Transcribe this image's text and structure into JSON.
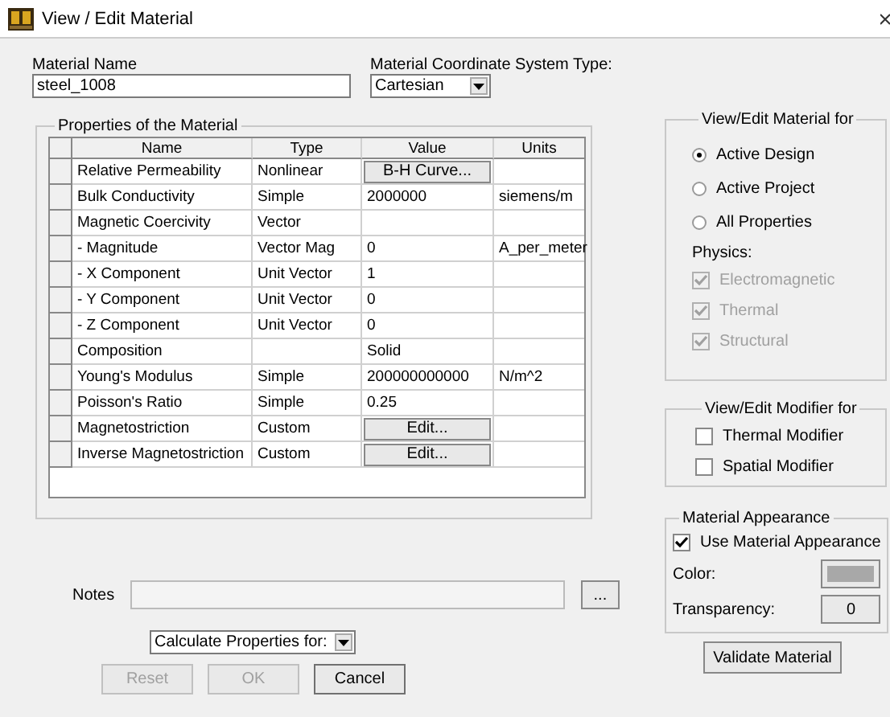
{
  "window": {
    "title": "View / Edit Material"
  },
  "material_name": {
    "label": "Material Name",
    "value": "steel_1008"
  },
  "coordinate_system": {
    "label": "Material Coordinate System Type:",
    "value": "Cartesian"
  },
  "properties": {
    "title": "Properties of the Material",
    "columns": [
      "Name",
      "Type",
      "Value",
      "Units"
    ],
    "rows": [
      {
        "name": "Relative Permeability",
        "type": "Nonlinear",
        "kind": "button",
        "value": "B-H Curve...",
        "units": ""
      },
      {
        "name": "Bulk Conductivity",
        "type": "Simple",
        "kind": "text",
        "value": "2000000",
        "units": "siemens/m"
      },
      {
        "name": "Magnetic Coercivity",
        "type": "Vector",
        "kind": "text",
        "value": "",
        "units": ""
      },
      {
        "name": "- Magnitude",
        "type": "Vector Mag",
        "kind": "text",
        "value": "0",
        "units": "A_per_meter"
      },
      {
        "name": "- X Component",
        "type": "Unit Vector",
        "kind": "text",
        "value": "1",
        "units": ""
      },
      {
        "name": "- Y Component",
        "type": "Unit Vector",
        "kind": "text",
        "value": "0",
        "units": ""
      },
      {
        "name": "- Z Component",
        "type": "Unit Vector",
        "kind": "text",
        "value": "0",
        "units": ""
      },
      {
        "name": "Composition",
        "type": "",
        "kind": "text",
        "value": "Solid",
        "units": ""
      },
      {
        "name": "Young's Modulus",
        "type": "Simple",
        "kind": "text",
        "value": "200000000000",
        "units": "N/m^2"
      },
      {
        "name": "Poisson's Ratio",
        "type": "Simple",
        "kind": "text",
        "value": "0.25",
        "units": ""
      },
      {
        "name": "Magnetostriction",
        "type": "Custom",
        "kind": "button",
        "value": "Edit...",
        "units": ""
      },
      {
        "name": "Inverse Magnetostriction",
        "type": "Custom",
        "kind": "button",
        "value": "Edit...",
        "units": ""
      }
    ]
  },
  "view_edit_for": {
    "title": "View/Edit Material for",
    "options": [
      {
        "label": "Active Design",
        "selected": true
      },
      {
        "label": "Active Project",
        "selected": false
      },
      {
        "label": "All Properties",
        "selected": false
      }
    ],
    "physics_label": "Physics:",
    "physics": [
      {
        "label": "Electromagnetic",
        "checked": true,
        "disabled": true
      },
      {
        "label": "Thermal",
        "checked": true,
        "disabled": true
      },
      {
        "label": "Structural",
        "checked": true,
        "disabled": true
      }
    ]
  },
  "modifier_for": {
    "title": "View/Edit Modifier for",
    "options": [
      {
        "label": "Thermal Modifier",
        "checked": false
      },
      {
        "label": "Spatial Modifier",
        "checked": false
      }
    ]
  },
  "appearance": {
    "title": "Material Appearance",
    "use": {
      "label": "Use Material Appearance",
      "checked": true
    },
    "color_label": "Color:",
    "transparency_label": "Transparency:",
    "transparency": "0"
  },
  "validate_button": "Validate Material",
  "notes": {
    "label": "Notes",
    "browse": "..."
  },
  "calculate": {
    "value": "Calculate Properties for:"
  },
  "buttons": [
    {
      "label": "Reset",
      "disabled": true
    },
    {
      "label": "OK",
      "disabled": true
    },
    {
      "label": "Cancel",
      "disabled": false
    }
  ]
}
